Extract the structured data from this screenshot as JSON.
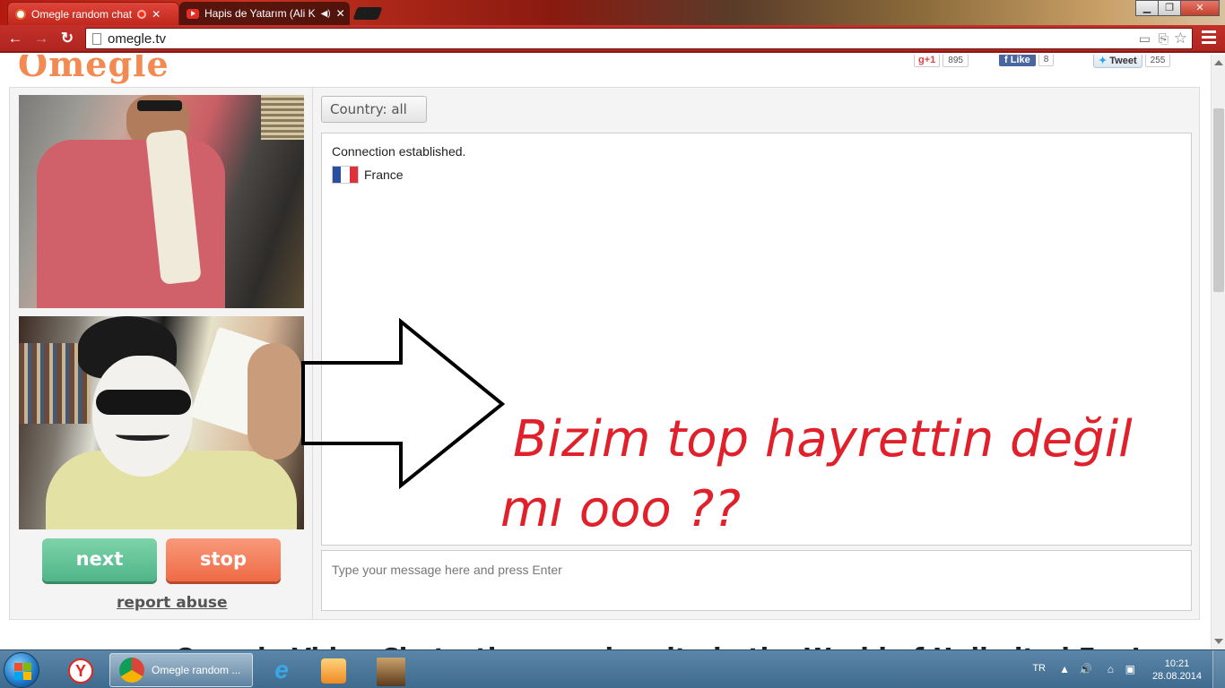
{
  "browser": {
    "tabs": [
      {
        "title": "Omegle random chat",
        "active": true
      },
      {
        "title": "Hapis de Yatarım (Ali K",
        "active": false
      }
    ],
    "url": "omegle.tv"
  },
  "page": {
    "logo": "Omegle",
    "social": {
      "gplus_label": "+1",
      "gplus_count": "895",
      "fb_label": "Like",
      "fb_count": "8",
      "tweet_label": "Tweet",
      "tweet_count": "255"
    },
    "controls": {
      "next_label": "next",
      "stop_label": "stop",
      "report_label": "report abuse",
      "country_label": "Country: all"
    },
    "chat_log": {
      "status": "Connection established.",
      "country": "France",
      "flag_colors": [
        "#2a4fa0",
        "#ffffff",
        "#e0303a"
      ]
    },
    "message_input": {
      "placeholder": "Type your message here and press Enter",
      "value": ""
    },
    "overlay": {
      "line1": "Bizim top hayrettin değil",
      "line2": "mı ooo ??",
      "color": "#e0202a"
    },
    "footer_partial": "Omegle Video Chat – the premier site in the World of Unlimited Fun!"
  },
  "taskbar": {
    "chrome_label": "Omegle random ...",
    "language": "TR",
    "time": "10:21",
    "date": "28.08.2014"
  }
}
